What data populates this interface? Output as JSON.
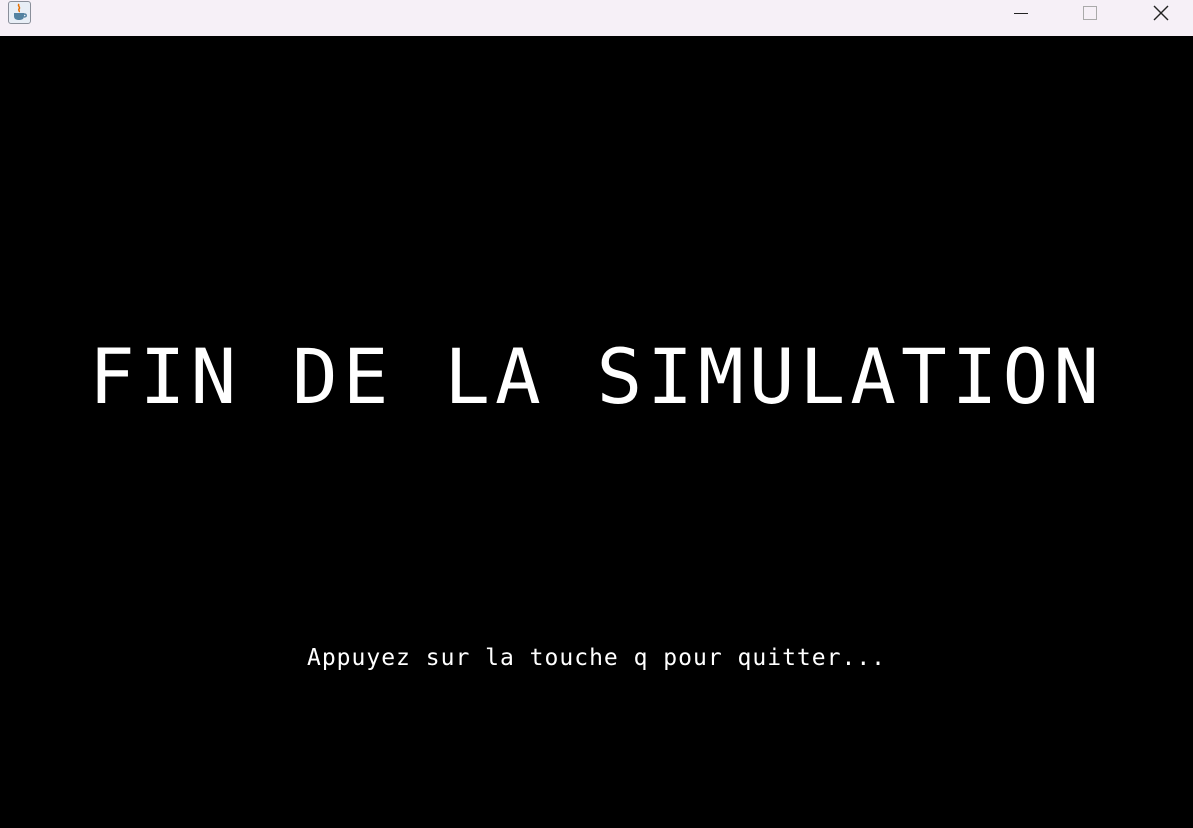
{
  "window": {
    "app_icon": "java-coffee-cup-icon",
    "controls": {
      "minimize_icon": "minimize-icon",
      "maximize_icon": "maximize-icon",
      "close_icon": "close-icon"
    },
    "titlebar_color": "#f6f0f7",
    "background_color": "#000000"
  },
  "screen": {
    "title": "FIN DE LA SIMULATION",
    "instruction": "Appuyez sur la touche q pour quitter...",
    "text_color": "#ffffff"
  }
}
